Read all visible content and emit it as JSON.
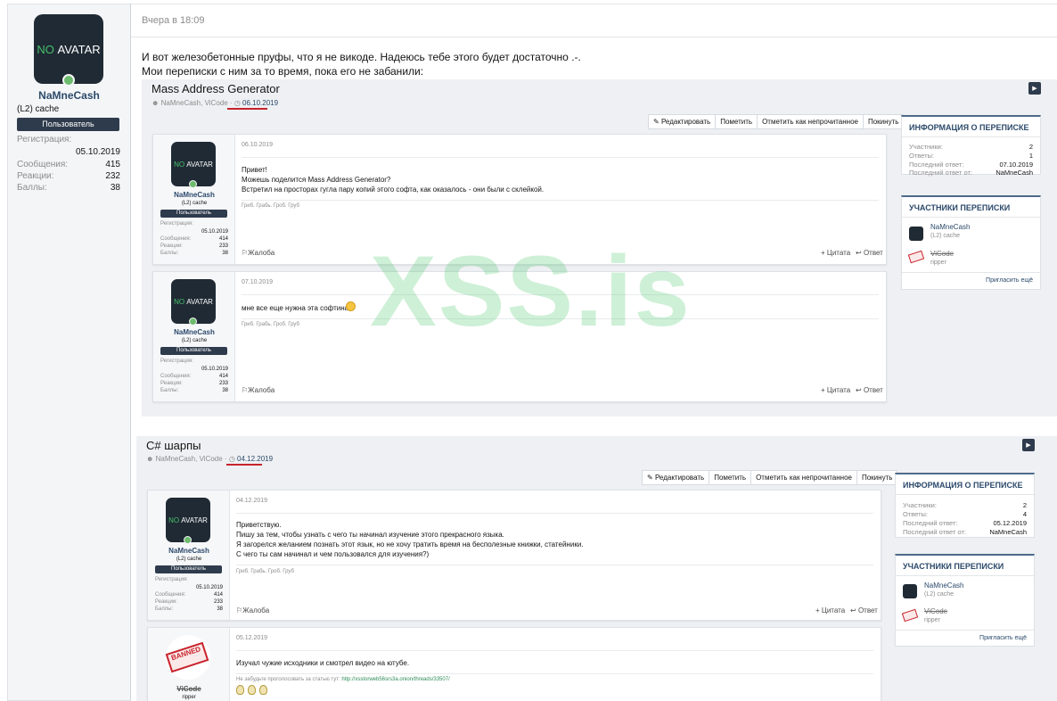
{
  "author": {
    "avatar_text": "NO AVATAR",
    "avatar_no": "NO",
    "avatar_rest": "AVATAR",
    "name": "NaMneCash",
    "title": "(L2) cache",
    "badge": "Пользователь",
    "registration_label": "Регистрация:",
    "registration_date": "05.10.2019",
    "stats": [
      {
        "label": "Сообщения:",
        "value": "415"
      },
      {
        "label": "Реакции:",
        "value": "232"
      },
      {
        "label": "Баллы:",
        "value": "38"
      }
    ]
  },
  "post": {
    "date": "Вчера в 18:09",
    "lines": [
      "И вот железобетонные пруфы, что я не викоде. Надеюсь тебе этого будет достаточно .-.",
      "Мои переписки с ним за то время, пока его не забанили:"
    ]
  },
  "watermark": "XSS.is",
  "threads": [
    {
      "title": "Mass Address Generator",
      "participants": "NaMneCash, ViCode",
      "sep": "·",
      "date": "06.10.2019",
      "toolbar": [
        "Редактировать",
        "Пометить",
        "Отметить как непрочитанное",
        "Покинуть"
      ],
      "messages": [
        {
          "author": "NaMneCash",
          "title": "(L2) cache",
          "badge": "Пользователь",
          "reg_label": "Регистрация:",
          "reg": "05.10.2019",
          "stats": [
            [
              "Сообщения:",
              "414"
            ],
            [
              "Реакции:",
              "233"
            ],
            [
              "Баллы:",
              "38"
            ]
          ],
          "date": "06.10.2019",
          "lines": [
            "Привет!",
            "Можешь поделится Mass Address Generator?",
            "Встретил на просторах гугла пару копий этого софта, как оказалось - они были с склейкой."
          ],
          "sig": "Гриб. Грабь. Гроб. Груб",
          "report": "Жалоба",
          "quote": "+ Цитата",
          "reply": "Ответ"
        },
        {
          "author": "NaMneCash",
          "title": "(L2) cache",
          "badge": "Пользователь",
          "reg_label": "Регистрация:",
          "reg": "05.10.2019",
          "stats": [
            [
              "Сообщения:",
              "414"
            ],
            [
              "Реакции:",
              "233"
            ],
            [
              "Баллы:",
              "38"
            ]
          ],
          "date": "07.10.2019",
          "lines": [
            "мне все еще нужна эта софтина"
          ],
          "sig": "Гриб. Грабь. Гроб. Груб",
          "report": "Жалоба",
          "quote": "+ Цитата",
          "reply": "Ответ"
        }
      ],
      "info": {
        "head": "ИНФОРМАЦИЯ О ПЕРЕПИСКЕ",
        "rows": [
          [
            "Участники:",
            "2"
          ],
          [
            "Ответы:",
            "1"
          ],
          [
            "Последний ответ:",
            "07.10.2019"
          ],
          [
            "Последний ответ от:",
            "NaMneCash"
          ]
        ]
      },
      "participants_box": {
        "head": "УЧАСТНИКИ ПЕРЕПИСКИ",
        "people": [
          {
            "name": "NaMneCash",
            "sub": "(L2) cache"
          },
          {
            "name": "ViCode",
            "sub": "ripper"
          }
        ],
        "invite": "Пригласить ещё"
      }
    },
    {
      "title": "C# шарпы",
      "participants": "NaMneCash, ViCode",
      "sep": "·",
      "date": "04.12.2019",
      "toolbar": [
        "Редактировать",
        "Пометить",
        "Отметить как непрочитанное",
        "Покинуть"
      ],
      "messages": [
        {
          "author": "NaMneCash",
          "title": "(L2) cache",
          "badge": "Пользователь",
          "reg_label": "Регистрация:",
          "reg": "05.10.2019",
          "stats": [
            [
              "Сообщения:",
              "414"
            ],
            [
              "Реакции:",
              "233"
            ],
            [
              "Баллы:",
              "38"
            ]
          ],
          "date": "04.12.2019",
          "lines": [
            "Приветствую.",
            "Пишу за тем, чтобы узнать с чего ты начинал изучение этого прекрасного языка.",
            "Я загорелся желанием познать этот язык, но не хочу тратить время на бесполезные книжки, статейники.",
            "С чего ты сам начинал и чем пользовался для изучения?)"
          ],
          "sig": "Гриб. Грабь. Гроб. Груб",
          "report": "Жалоба",
          "quote": "+ Цитата",
          "reply": "Ответ"
        },
        {
          "author": "ViCode",
          "title": "ripper",
          "banned": "BANNED",
          "date": "05.12.2019",
          "lines": [
            "Изучал чужие исходники и смотрел видео на ютубе."
          ],
          "sig": "Не забудьте проголосовать за статью тут:",
          "sig_link": "http://xsstorweb56srs3a.onion/threads/33507/"
        }
      ],
      "info": {
        "head": "ИНФОРМАЦИЯ О ПЕРЕПИСКЕ",
        "rows": [
          [
            "Участники:",
            "2"
          ],
          [
            "Ответы:",
            "4"
          ],
          [
            "Последний ответ:",
            "05.12.2019"
          ],
          [
            "Последний ответ от:",
            "NaMneCash"
          ]
        ]
      },
      "participants_box": {
        "head": "УЧАСТНИКИ ПЕРЕПИСКИ",
        "people": [
          {
            "name": "NaMneCash",
            "sub": "(L2) cache"
          },
          {
            "name": "ViCode",
            "sub": "ripper"
          }
        ],
        "invite": "Пригласить ещё"
      }
    }
  ],
  "colors": {
    "accent": "#2c4a6b",
    "underline": "#c8232c",
    "badge": "#2e3b4c",
    "watermark": "#50c86e"
  }
}
